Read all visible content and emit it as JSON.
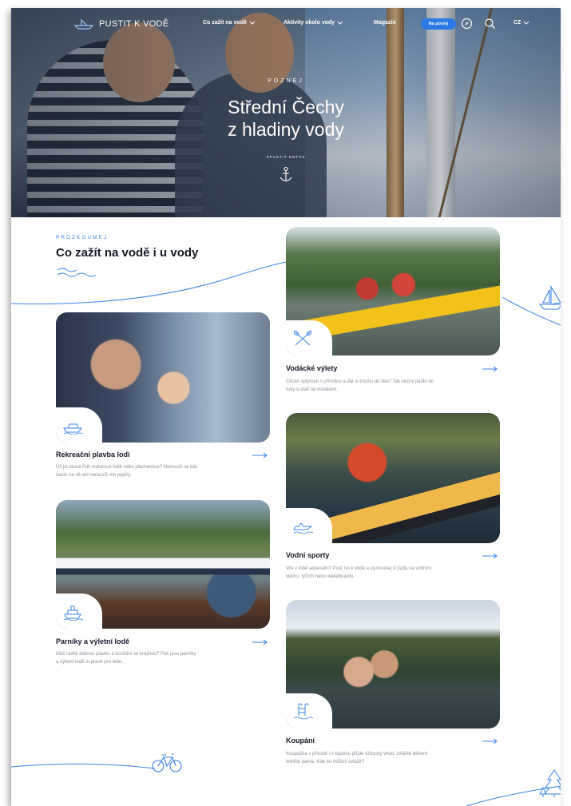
{
  "nav": {
    "logo_text": "PUSTIT K VODĚ",
    "links": [
      {
        "label": "Co zažít na vodě",
        "has_dropdown": true
      },
      {
        "label": "Aktivity okolo vody",
        "has_dropdown": true
      },
      {
        "label": "Magazín",
        "has_dropdown": false
      }
    ],
    "cta_label": "Na poslej",
    "language": "CZ",
    "icons": [
      "compass-icon",
      "search-icon",
      "chevron-down-icon"
    ]
  },
  "hero": {
    "eyebrow": "POZNEJ",
    "title_line1": "Střední Čechy",
    "title_line2": "z hladiny vody",
    "scroll_label": "SPUSTIT KOTVU",
    "icon": "anchor-icon"
  },
  "section": {
    "eyebrow": "PROZKOUMEJ",
    "title": "Co zažít na vodě i u vody"
  },
  "cards": [
    {
      "title": "Rekreační plavba lodí",
      "desc_line1": "Už jsi zkusil řídit motorové lodě nebo plachetnice? Nemusíš se bát,",
      "desc_line2": "často na ně ani nemusíš mít papíry.",
      "icon": "motorboat-icon"
    },
    {
      "title": "Parníky a výletní lodě",
      "desc_line1": "Máš raději klidnou plavbu a kochání se krajinou? Pak jsou parníky",
      "desc_line2": "a výletní lodě to pravé pro tebe.",
      "icon": "steamship-icon"
    },
    {
      "title": "Vodácké výlety",
      "desc_line1": "Chceš splynout s přírodou a dát si trochu do těla? Tak vezmi pádlo do",
      "desc_line2": "ruky a staň se vodákem.",
      "icon": "paddles-icon"
    },
    {
      "title": "Vodní sporty",
      "desc_line1": "Vře v tobě adrenalin? Pusť ho k vodě a vyzkoušej si jízdu na vodním",
      "desc_line2": "skútru, lyžích nebo wakeboardu.",
      "icon": "jetski-icon"
    },
    {
      "title": "Koupání",
      "desc_line1": "Koupačka v přírodě i v bazénu přijde vždycky vhod, zvláště během",
      "desc_line2": "letního parna. Kde se můžeš svlažit?",
      "icon": "swimming-pool-icon"
    }
  ],
  "colors": {
    "accent": "#2a79e6",
    "wave": "#3b83e6",
    "title": "#141a26",
    "desc": "#8a919c"
  }
}
